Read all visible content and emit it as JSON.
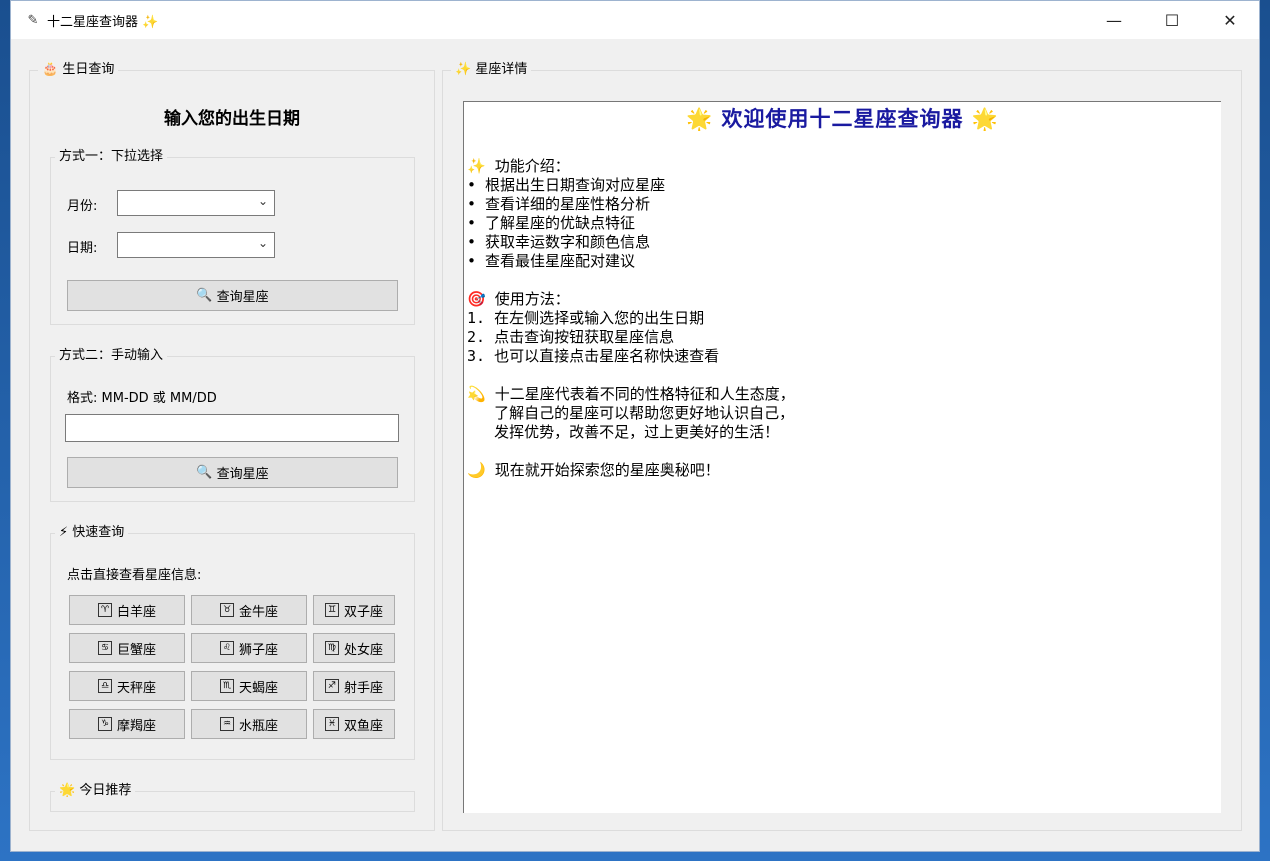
{
  "titlebar": {
    "title": "十二星座查询器 ✨",
    "app_icon": "feather-icon",
    "minimize": "—",
    "maximize": "☐",
    "close": "✕"
  },
  "birthday": {
    "group_title": "🎂 生日查询",
    "heading": "输入您的出生日期",
    "method1": {
      "title": "方式一：下拉选择",
      "month_label": "月份:",
      "day_label": "日期:",
      "month_value": "",
      "day_value": "",
      "query_label": "查询星座"
    },
    "method2": {
      "title": "方式二：手动输入",
      "format_label": "格式: MM-DD 或 MM/DD",
      "input_value": "",
      "query_label": "查询星座"
    }
  },
  "quick": {
    "title": "⚡ 快速查询",
    "hint": "点击直接查看星座信息:",
    "signs": [
      {
        "symbol": "♈",
        "name": "白羊座"
      },
      {
        "symbol": "♉",
        "name": "金牛座"
      },
      {
        "symbol": "♊",
        "name": "双子座"
      },
      {
        "symbol": "♋",
        "name": "巨蟹座"
      },
      {
        "symbol": "♌",
        "name": "狮子座"
      },
      {
        "symbol": "♍",
        "name": "处女座"
      },
      {
        "symbol": "♎",
        "name": "天秤座"
      },
      {
        "symbol": "♏",
        "name": "天蝎座"
      },
      {
        "symbol": "♐",
        "name": "射手座"
      },
      {
        "symbol": "♑",
        "name": "摩羯座"
      },
      {
        "symbol": "♒",
        "name": "水瓶座"
      },
      {
        "symbol": "♓",
        "name": "双鱼座"
      }
    ]
  },
  "today": {
    "title": "🌟 今日推荐"
  },
  "detail": {
    "group_title": "✨ 星座详情",
    "welcome": "🌟 欢迎使用十二星座查询器 🌟",
    "lines": [
      "✨ 功能介绍：",
      "• 根据出生日期查询对应星座",
      "• 查看详细的星座性格分析",
      "• 了解星座的优缺点特征",
      "• 获取幸运数字和颜色信息",
      "• 查看最佳星座配对建议",
      "",
      "🎯 使用方法：",
      "1. 在左侧选择或输入您的出生日期",
      "2. 点击查询按钮获取星座信息",
      "3. 也可以直接点击星座名称快速查看",
      "",
      "💫 十二星座代表着不同的性格特征和人生态度，",
      "   了解自己的星座可以帮助您更好地认识自己，",
      "   发挥优势，改善不足，过上更美好的生活！",
      "",
      "🌙 现在就开始探索您的星座奥秘吧！"
    ]
  }
}
